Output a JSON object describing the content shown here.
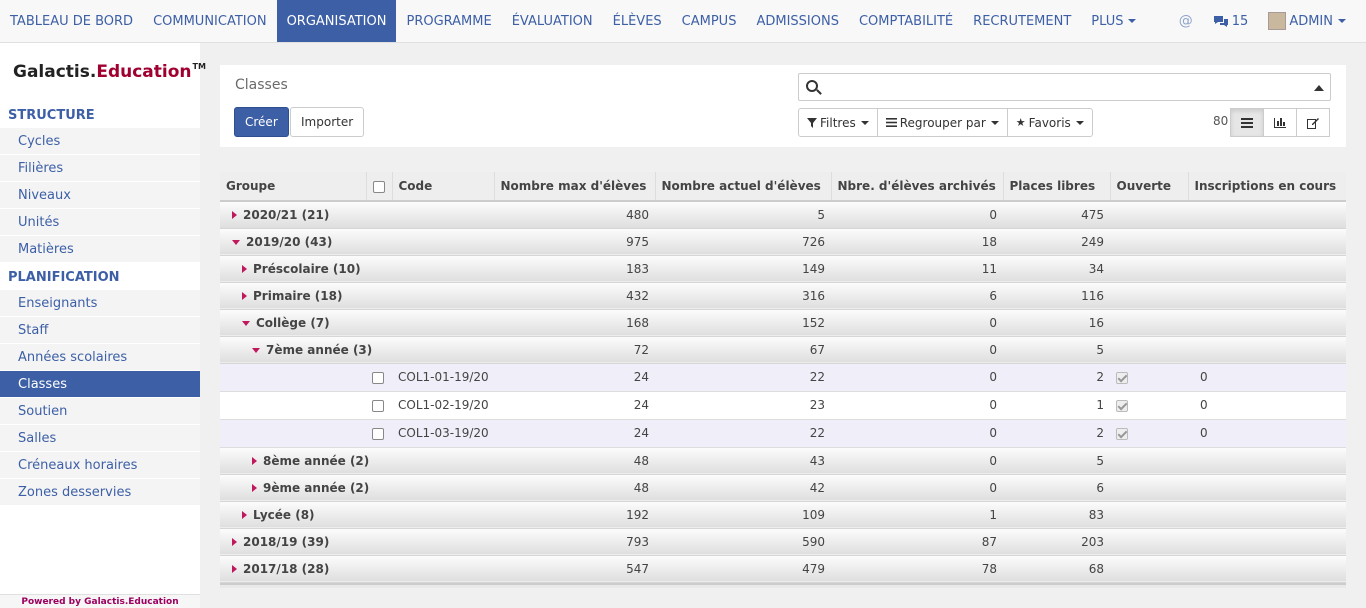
{
  "nav": {
    "items": [
      "TABLEAU DE BORD",
      "COMMUNICATION",
      "ORGANISATION",
      "PROGRAMME",
      "ÉVALUATION",
      "ÉLÈVES",
      "CAMPUS",
      "ADMISSIONS",
      "COMPTABILITÉ",
      "RECRUTEMENT"
    ],
    "more_label": "PLUS",
    "active": "ORGANISATION",
    "at_icon": "at-icon",
    "messages_count": "15",
    "user_label": "ADMIN",
    "accent_color": "#3c5fa6"
  },
  "sidebar": {
    "logo_main": "Galactis.",
    "logo_accent": "Education",
    "logo_tm": "TM",
    "sections": [
      {
        "title": "STRUCTURE",
        "items": [
          "Cycles",
          "Filières",
          "Niveaux",
          "Unités",
          "Matières"
        ]
      },
      {
        "title": "PLANIFICATION",
        "items": [
          "Enseignants",
          "Staff",
          "Années scolaires",
          "Classes",
          "Soutien",
          "Salles",
          "Créneaux horaires",
          "Zones desservies"
        ]
      }
    ],
    "active_item": "Classes",
    "powered_by": "Powered by Galactis.Education"
  },
  "control_panel": {
    "breadcrumb": "Classes",
    "create_label": "Créer",
    "import_label": "Importer",
    "search_placeholder": "",
    "filters_label": "Filtres",
    "group_by_label": "Regrouper par",
    "favorites_label": "Favoris",
    "pager": "80"
  },
  "table": {
    "columns": [
      "Groupe",
      "",
      "Code",
      "Nombre max d'élèves",
      "Nombre actuel d'élèves",
      "Nbre. d'élèves archivés",
      "Places libres",
      "Ouverte",
      "Inscriptions en cours"
    ],
    "rows": [
      {
        "type": "group",
        "level": 0,
        "open": false,
        "label": "2020/21 (21)",
        "max": "480",
        "current": "5",
        "archived": "0",
        "free": "475"
      },
      {
        "type": "group",
        "level": 0,
        "open": true,
        "label": "2019/20 (43)",
        "max": "975",
        "current": "726",
        "archived": "18",
        "free": "249"
      },
      {
        "type": "group",
        "level": 1,
        "open": false,
        "label": "Préscolaire (10)",
        "max": "183",
        "current": "149",
        "archived": "11",
        "free": "34"
      },
      {
        "type": "group",
        "level": 1,
        "open": false,
        "label": "Primaire (18)",
        "max": "432",
        "current": "316",
        "archived": "6",
        "free": "116"
      },
      {
        "type": "group",
        "level": 1,
        "open": true,
        "label": "Collège (7)",
        "max": "168",
        "current": "152",
        "archived": "0",
        "free": "16"
      },
      {
        "type": "group",
        "level": 2,
        "open": true,
        "label": "7ème année (3)",
        "max": "72",
        "current": "67",
        "archived": "0",
        "free": "5"
      },
      {
        "type": "record",
        "code": "COL1-01-19/20",
        "max": "24",
        "current": "22",
        "archived": "0",
        "free": "2",
        "open": true,
        "enrolling": "0"
      },
      {
        "type": "record",
        "code": "COL1-02-19/20",
        "max": "24",
        "current": "23",
        "archived": "0",
        "free": "1",
        "open": true,
        "enrolling": "0"
      },
      {
        "type": "record",
        "code": "COL1-03-19/20",
        "max": "24",
        "current": "22",
        "archived": "0",
        "free": "2",
        "open": true,
        "enrolling": "0"
      },
      {
        "type": "group",
        "level": 2,
        "open": false,
        "label": "8ème année (2)",
        "max": "48",
        "current": "43",
        "archived": "0",
        "free": "5"
      },
      {
        "type": "group",
        "level": 2,
        "open": false,
        "label": "9ème année (2)",
        "max": "48",
        "current": "42",
        "archived": "0",
        "free": "6"
      },
      {
        "type": "group",
        "level": 1,
        "open": false,
        "label": "Lycée (8)",
        "max": "192",
        "current": "109",
        "archived": "1",
        "free": "83"
      },
      {
        "type": "group",
        "level": 0,
        "open": false,
        "label": "2018/19 (39)",
        "max": "793",
        "current": "590",
        "archived": "87",
        "free": "203"
      },
      {
        "type": "group",
        "level": 0,
        "open": false,
        "label": "2017/18 (28)",
        "max": "547",
        "current": "479",
        "archived": "78",
        "free": "68"
      }
    ]
  }
}
